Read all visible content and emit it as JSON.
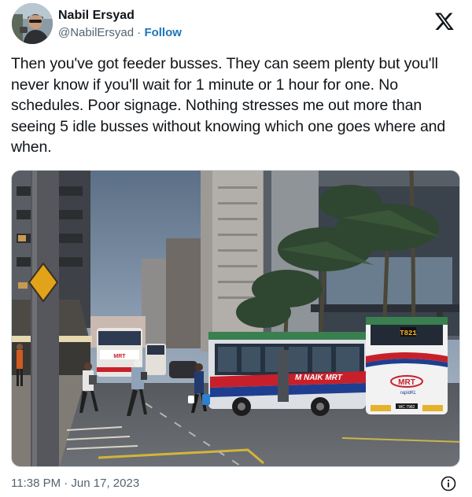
{
  "author": {
    "display_name": "Nabil Ersyad",
    "handle": "@NabilErsyad",
    "separator": "·",
    "follow_label": "Follow"
  },
  "platform_logo": "x-logo-icon",
  "tweet": {
    "text": "Then you've got feeder busses. They can seem plenty but you'll never know if you'll wait for 1 minute or 1 hour for one. No schedules. Poor signage. Nothing stresses me out more than seeing 5 idle busses without knowing which one goes where and when."
  },
  "photo": {
    "bus_route_display": "T821",
    "bus_side_text": "M NAIK MRT",
    "bus_rear_logo": "MRT",
    "bus_rear_sub": "rapidKL",
    "bus_plate": "WC 7982",
    "far_bus_sign": "MRT"
  },
  "footer": {
    "timestamp": "11:38 PM · Jun 17, 2023",
    "info_icon": "info-icon"
  },
  "colors": {
    "follow_link": "#1d74b8",
    "secondary_text": "#536471",
    "bus_red": "#c8202b",
    "bus_blue": "#1e3f8f"
  }
}
